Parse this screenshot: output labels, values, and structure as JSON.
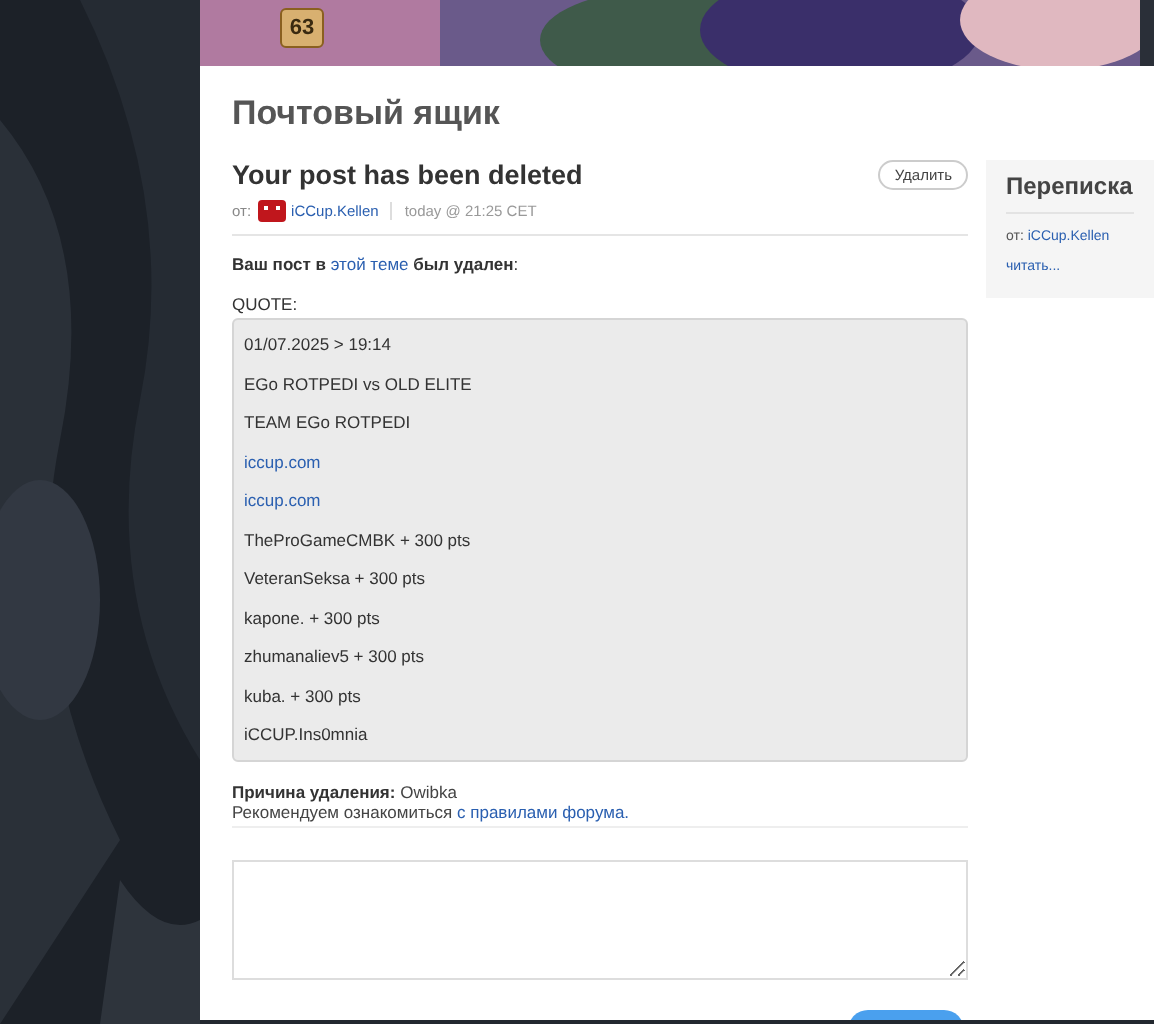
{
  "header": {
    "level_badge": "63"
  },
  "page_title": "Почтовый ящик",
  "message": {
    "title": "Your post has been deleted",
    "delete_button": "Удалить",
    "from_label": "от:",
    "author": "iCCup.Kellen",
    "time": "today @ 21:25 CET",
    "intro_start": "Ваш пост в",
    "intro_link": "этой теме",
    "intro_end": "**был удален**:",
    "quote_label": "QUOTE:",
    "quote_lines": [
      {
        "text": "01/07.2025 > 19:14",
        "kind": "text"
      },
      {
        "text": "EGo ROTPEDI vs OLD ELITE",
        "kind": "text"
      },
      {
        "text": "TEAM EGo ROTPEDI",
        "kind": "text"
      },
      {
        "text": "iccup.com",
        "kind": "link"
      },
      {
        "text": "iccup.com",
        "kind": "link"
      },
      {
        "text": "TheProGameCMBK + 300 pts",
        "kind": "text"
      },
      {
        "text": "VeteranSeksa + 300 pts",
        "kind": "text"
      },
      {
        "text": "kapone. + 300 pts",
        "kind": "text"
      },
      {
        "text": "zhumanaliev5 + 300 pts",
        "kind": "text"
      },
      {
        "text": "kuba. + 300 pts",
        "kind": "text"
      },
      {
        "text": "iCCUP.Ins0mnia",
        "kind": "text"
      }
    ],
    "reason_label": "Причина удаления:",
    "reason": "Owibka",
    "advice": "Рекомендуем ознакомиться",
    "advice_link": "с правилами форума."
  },
  "sidebar": {
    "title": "Переписка",
    "from_label": "от:",
    "author": "iCCup.Kellen",
    "read_link": "читать..."
  }
}
